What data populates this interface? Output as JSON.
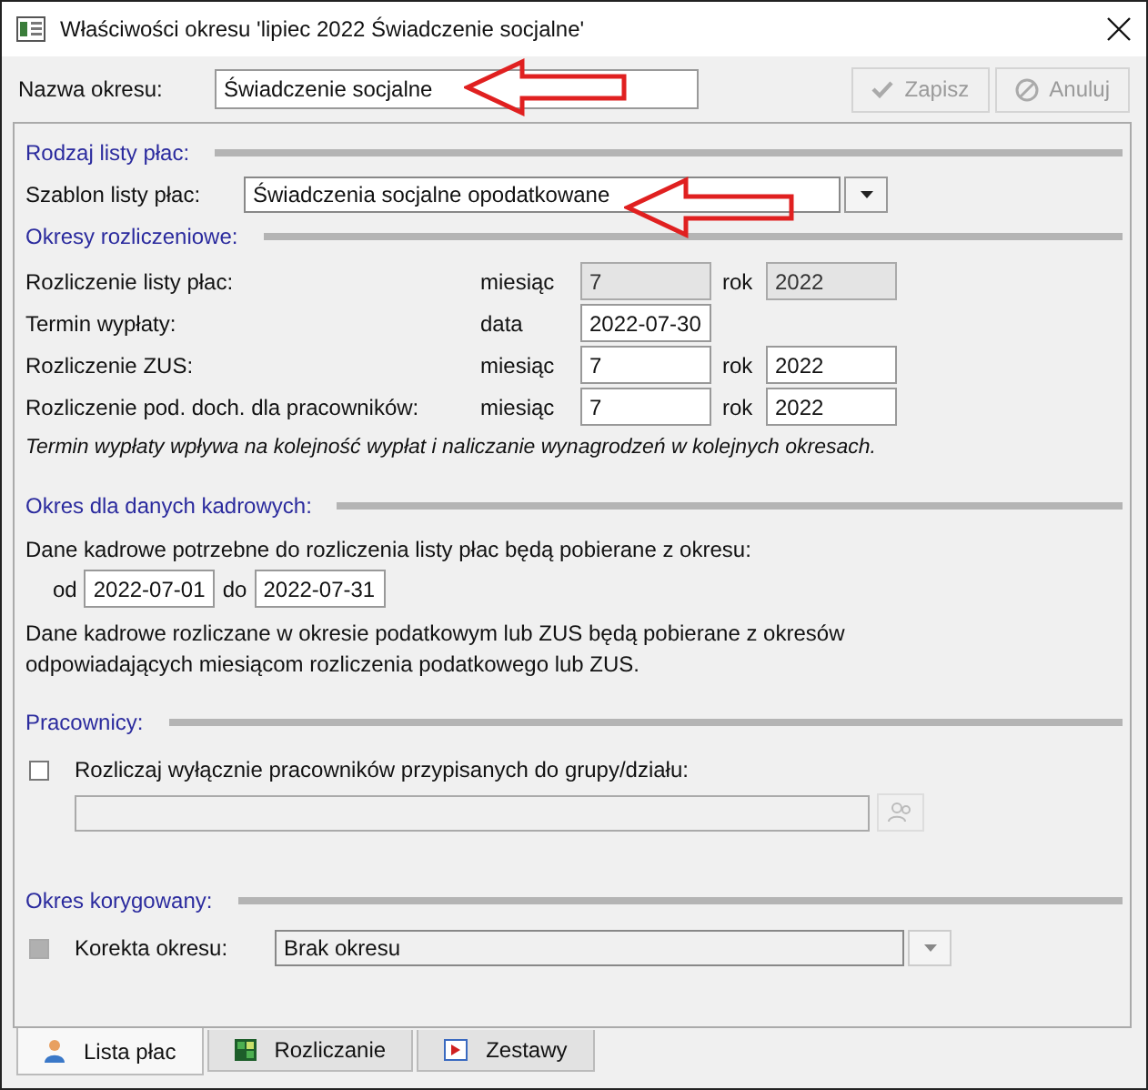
{
  "window": {
    "title": "Właściwości okresu 'lipiec 2022 Świadczenie socjalne'"
  },
  "name_field": {
    "label": "Nazwa okresu:",
    "value": "Świadczenie socjalne"
  },
  "buttons": [
    {
      "label": "Zapisz",
      "kind": "save",
      "disabled": true
    },
    {
      "label": "Anuluj",
      "kind": "cancel",
      "disabled": true
    }
  ],
  "payroll_type": {
    "heading": "Rodzaj listy płac:",
    "template_label": "Szablon listy płac:",
    "template_value": "Świadczenia socjalne opodatkowane"
  },
  "periods": {
    "heading": "Okresy rozliczeniowe:",
    "rows": [
      {
        "label": "Rozliczenie listy płac:",
        "unit": "miesiąc",
        "value": "7",
        "disabled": true,
        "year_label": "rok",
        "year": "2022"
      },
      {
        "label": "Termin wypłaty:",
        "unit": "data",
        "value": "2022-07-30",
        "disabled": false
      },
      {
        "label": "Rozliczenie ZUS:",
        "unit": "miesiąc",
        "value": "7",
        "disabled": false,
        "year_label": "rok",
        "year": "2022"
      },
      {
        "label": "Rozliczenie pod. doch. dla pracowników:",
        "unit": "miesiąc",
        "value": "7",
        "disabled": false,
        "year_label": "rok",
        "year": "2022"
      }
    ],
    "note": "Termin wypłaty wpływa na kolejność wypłat i naliczanie wynagrodzeń w kolejnych okresach."
  },
  "hr_period": {
    "heading": "Okres dla danych kadrowych:",
    "text": "Dane kadrowe potrzebne do rozliczenia listy płac będą pobierane z okresu:",
    "from_label": "od",
    "from": "2022-07-01",
    "to_label": "do",
    "to": "2022-07-31",
    "note": "Dane kadrowe rozliczane w okresie podatkowym lub ZUS będą pobierane z okresów odpowiadających miesiącom rozliczenia podatkowego lub ZUS."
  },
  "employees": {
    "heading": "Pracownicy:",
    "checkbox": {
      "label": "Rozliczaj wyłącznie pracowników przypisanych do grupy/działu:",
      "checked": false,
      "disabled": false
    }
  },
  "correction": {
    "heading": "Okres korygowany:",
    "checkbox": {
      "label": "Korekta okresu:",
      "checked": false,
      "disabled": true
    },
    "value": "Brak okresu"
  },
  "tabs": [
    {
      "label": "Lista płac",
      "kind": "person",
      "selected": true
    },
    {
      "label": "Rozliczanie",
      "kind": "grid",
      "selected": false
    },
    {
      "label": "Zestawy",
      "kind": "report",
      "selected": false
    }
  ]
}
